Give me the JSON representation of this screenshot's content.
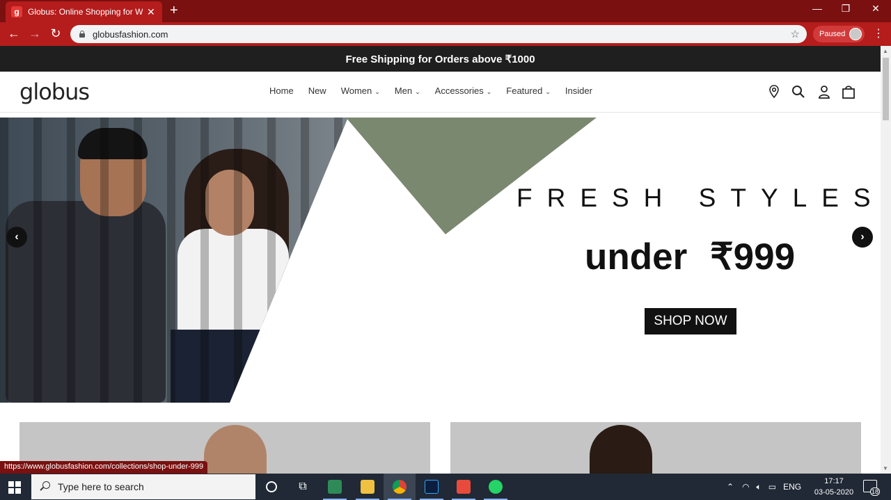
{
  "browser": {
    "tab_title": "Globus: Online Shopping for Women",
    "tab_favicon": "g",
    "url": "globusfashion.com",
    "profile_status": "Paused",
    "status_url": "https://www.globusfashion.com/collections/shop-under-999"
  },
  "site": {
    "announcement": "Free Shipping for Orders above ₹1000",
    "logo": "globus",
    "nav": [
      {
        "label": "Home",
        "dropdown": false
      },
      {
        "label": "New",
        "dropdown": false
      },
      {
        "label": "Women",
        "dropdown": true
      },
      {
        "label": "Men",
        "dropdown": true
      },
      {
        "label": "Accessories",
        "dropdown": true
      },
      {
        "label": "Featured",
        "dropdown": true
      },
      {
        "label": "Insider",
        "dropdown": false
      }
    ],
    "header_icons": [
      "location-pin-icon",
      "search-icon",
      "account-icon",
      "bag-icon"
    ]
  },
  "hero": {
    "headline": "FRESH STYLES",
    "price_line": "under ₹999",
    "cta": "SHOP NOW",
    "prev_arrow": "‹",
    "next_arrow": "›"
  },
  "taskbar": {
    "search_placeholder": "Type here to search",
    "language": "ENG",
    "time": "17:17",
    "date": "03-05-2020",
    "notification_count": "18"
  },
  "colors": {
    "chrome_frame": "#7a1010",
    "chrome_toolbar": "#b51c1c",
    "announcement_bg": "#1f1f1f",
    "hero_green": "#7b8870",
    "taskbar": "#202935"
  }
}
